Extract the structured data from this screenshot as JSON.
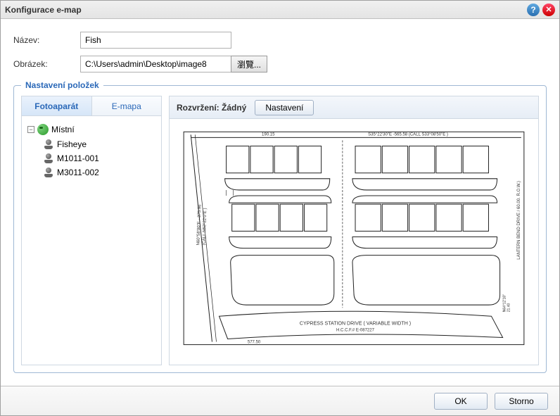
{
  "dialog": {
    "title": "Konfigurace e-map"
  },
  "form": {
    "name_label": "Název:",
    "name_value": "Fish",
    "image_label": "Obrázek:",
    "image_value": "C:\\Users\\admin\\Desktop\\image8",
    "browse_label": "瀏覽..."
  },
  "fieldset": {
    "legend": "Nastavení položek"
  },
  "tabs": {
    "camera": "Fotoaparát",
    "emap": "E-mapa"
  },
  "tree": {
    "root": "Místní",
    "items": [
      "Fisheye",
      "M1011-001",
      "M3011-002"
    ]
  },
  "right": {
    "layout_prefix": "Rozvržení: ",
    "layout_value": "Žádný",
    "settings": "Nastavení"
  },
  "map": {
    "label_top1": "190.15",
    "label_top2": "S35°22'30\"E -565.58  (CALL S33°08'50\"E )",
    "label_right": "LANTERN BEND DRIVE / 60.00.   R.O.W.)",
    "label_left1": "N60°58'00\"E - 375.96",
    "label_left2": "(CALL N52°22'0\"E )",
    "label_bottom1": "CYPRESS STATION DRIVE ( VARIABLE WIDTH )",
    "label_bottom2": "H.C.C.F.# E-087227",
    "label_br1": "N64°12'18\"",
    "label_br2": "21.40",
    "label_bl": "577.50"
  },
  "footer": {
    "ok": "OK",
    "cancel": "Storno"
  }
}
